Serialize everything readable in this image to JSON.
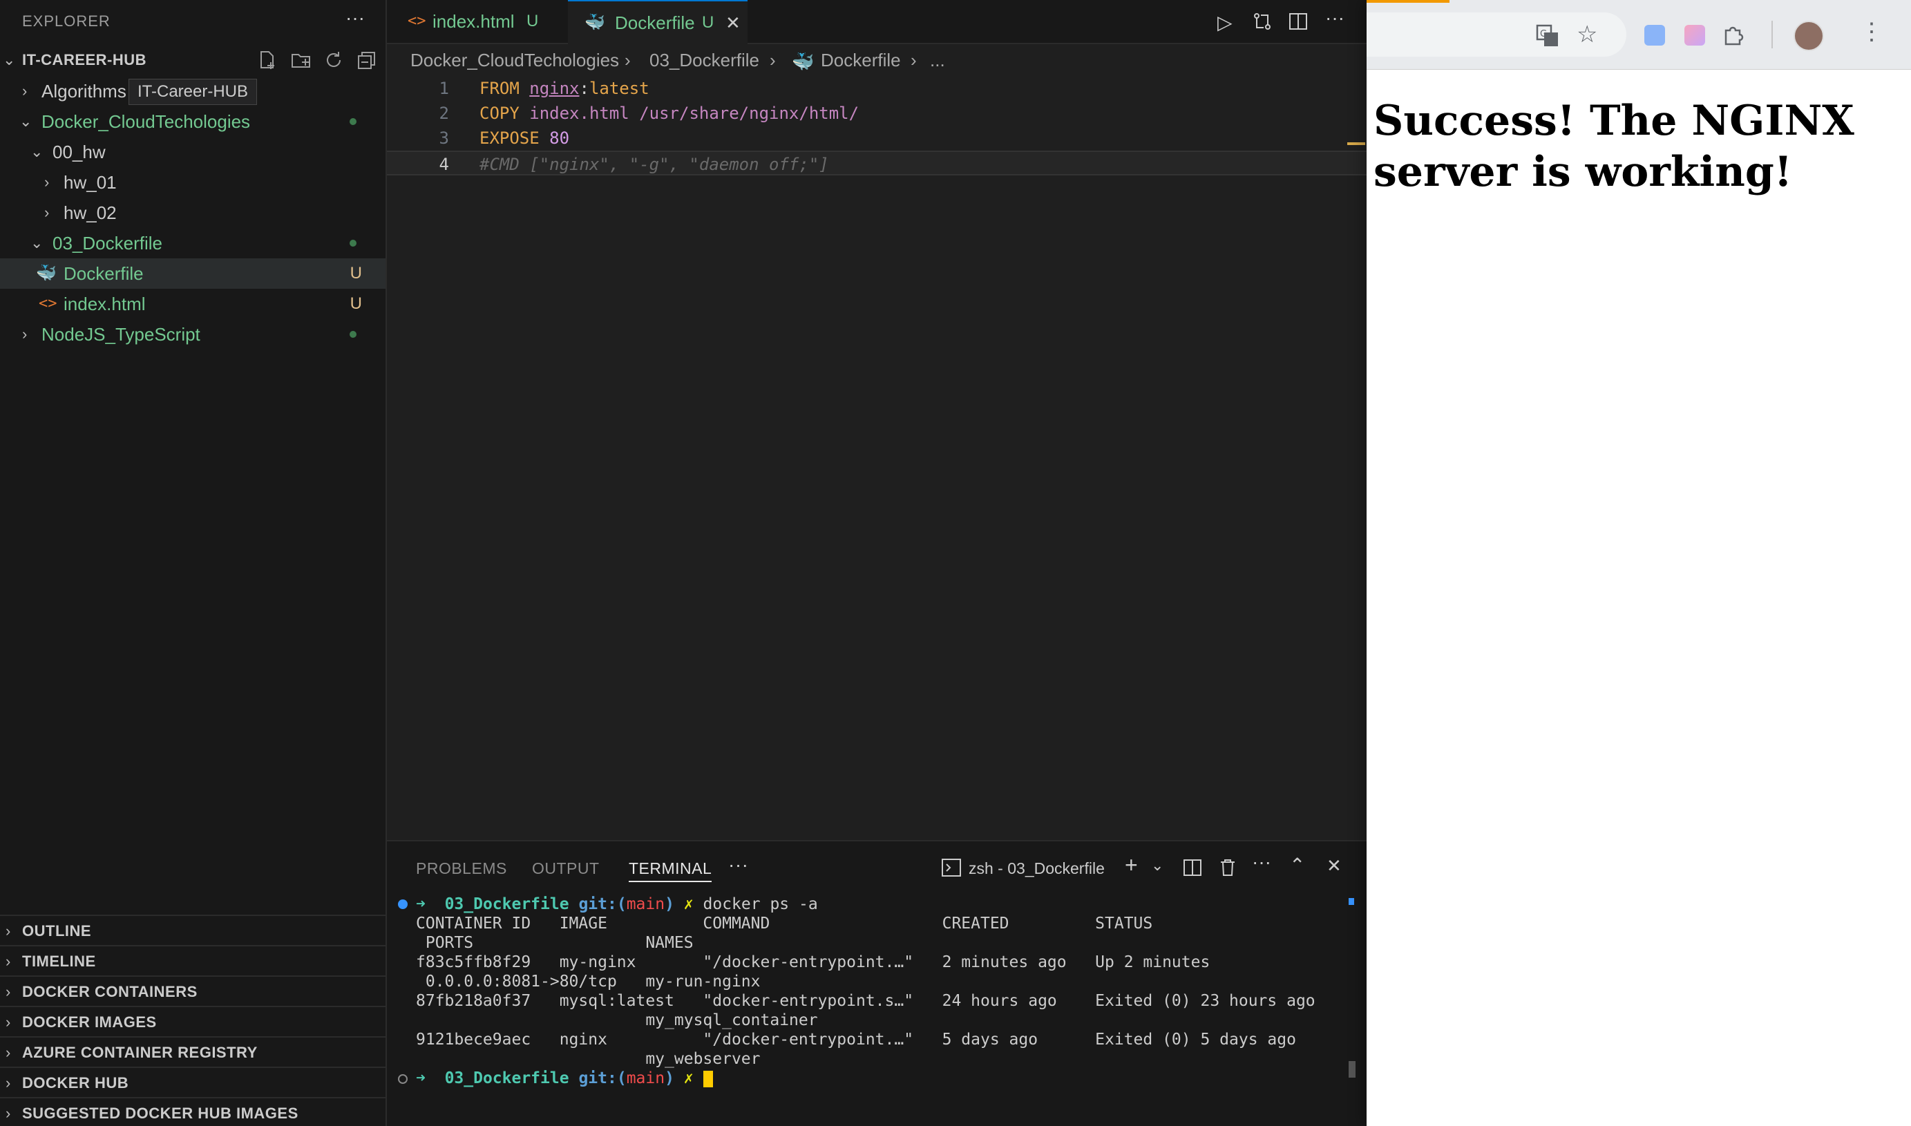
{
  "explorer": {
    "header": "EXPLORER",
    "project": "IT-CAREER-HUB",
    "tooltip": "IT-Career-HUB",
    "items": [
      {
        "label": "Algorithms"
      },
      {
        "label": "Docker_CloudTechologies"
      },
      {
        "label": "00_hw"
      },
      {
        "label": "hw_01"
      },
      {
        "label": "hw_02"
      },
      {
        "label": "03_Dockerfile"
      },
      {
        "label": "Dockerfile",
        "badge": "U"
      },
      {
        "label": "index.html",
        "badge": "U"
      },
      {
        "label": "NodeJS_TypeScript"
      }
    ],
    "panels": [
      "OUTLINE",
      "TIMELINE",
      "DOCKER CONTAINERS",
      "DOCKER IMAGES",
      "AZURE CONTAINER REGISTRY",
      "DOCKER HUB",
      "SUGGESTED DOCKER HUB IMAGES"
    ]
  },
  "tabs": [
    {
      "label": "index.html",
      "badge": "U"
    },
    {
      "label": "Dockerfile",
      "badge": "U"
    }
  ],
  "breadcrumb": [
    "Docker_CloudTechologies",
    "03_Dockerfile",
    "Dockerfile",
    "..."
  ],
  "code": [
    {
      "n": "1",
      "kw": "FROM",
      "image": "nginx",
      "sep": ":",
      "tag": "latest"
    },
    {
      "n": "2",
      "kw": "COPY",
      "rest": "index.html /usr/share/nginx/html/"
    },
    {
      "n": "3",
      "kw": "EXPOSE",
      "num": "80"
    },
    {
      "n": "4",
      "comment": "#CMD [\"nginx\", \"-g\", \"daemon off;\"]"
    }
  ],
  "panel": {
    "tabs": [
      "PROBLEMS",
      "OUTPUT",
      "TERMINAL"
    ],
    "terminal_name": "zsh - 03_Dockerfile"
  },
  "terminal": {
    "prompt_dir": "03_Dockerfile",
    "git_label": "git:(",
    "branch": "main",
    "git_close": ")",
    "x_mark": "✗",
    "command": "docker ps -a",
    "header1": "CONTAINER ID   IMAGE          COMMAND                  CREATED         STATUS",
    "header2": " PORTS                  NAMES",
    "rows": [
      {
        "line1": "f83c5ffb8f29   my-nginx       \"/docker-entrypoint.…\"   2 minutes ago   Up 2 minutes",
        "line2": " 0.0.0.0:8081->80/tcp   my-run-nginx"
      },
      {
        "line1": "87fb218a0f37   mysql:latest   \"docker-entrypoint.s…\"   24 hours ago    Exited (0) 23 hours ago",
        "line2": "                        my_mysql_container"
      },
      {
        "line1": "9121bece9aec   nginx          \"/docker-entrypoint.…\"   5 days ago      Exited (0) 5 days ago",
        "line2": "                        my_webserver"
      }
    ]
  },
  "browser": {
    "heading": "Success! The NGINX server is working!"
  }
}
